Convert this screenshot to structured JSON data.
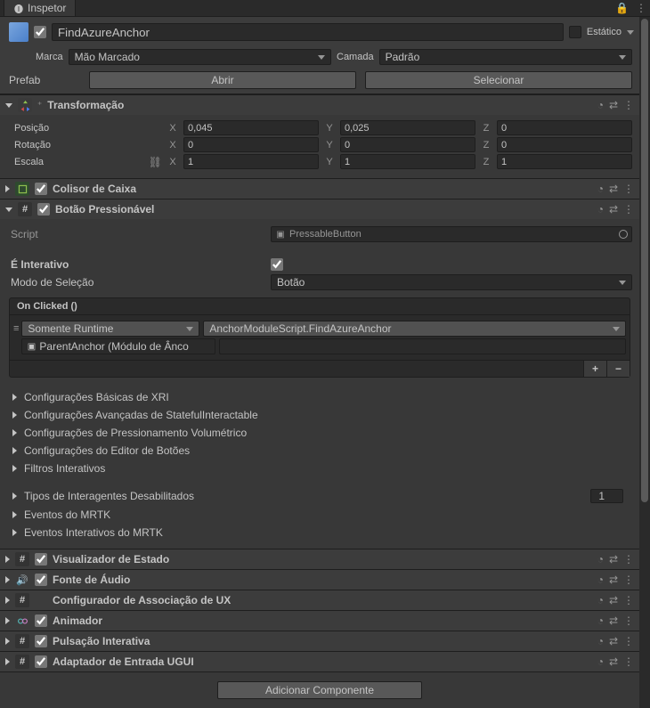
{
  "tab": {
    "title": "Inspetor"
  },
  "object": {
    "name": "FindAzureAnchor",
    "enabled": true,
    "static_label": "Estático",
    "tag_label": "Marca",
    "tag_value": "Mão Marcado",
    "layer_label": "Camada",
    "layer_value": "Padrão",
    "prefab_label": "Prefab",
    "open_btn": "Abrir",
    "select_btn": "Selecionar"
  },
  "transform": {
    "title": "Transformação",
    "position_label": "Posição",
    "rotation_label": "Rotação",
    "scale_label": "Escala",
    "pos": {
      "x": "0,045",
      "y": "0,025",
      "z": "0"
    },
    "rot": {
      "x": "0",
      "y": "0",
      "z": "0"
    },
    "scale": {
      "x": "1",
      "y": "1",
      "z": "1"
    }
  },
  "collider": {
    "title": "Colisor de Caixa",
    "enabled": true
  },
  "pressable": {
    "title": "Botão Pressionável",
    "enabled": true,
    "script_label": "Script",
    "script_value": "PressableButton",
    "interactive_label": "É Interativo",
    "interactive": true,
    "selection_label": "Modo de Seleção",
    "selection_value": "Botão",
    "event_title": "On Clicked ()",
    "runtime_value": "Somente Runtime",
    "target_value": "ParentAnchor (Módulo de Ânco",
    "function_value": "AnchorModuleScript.FindAzureAnchor"
  },
  "foldouts": {
    "xri_basic": "Configurações Básicas de XRI",
    "stateful": "Configurações Avançadas de StatefulInteractable",
    "volumetric": "Configurações de Pressionamento Volumétrico",
    "button_editor": "Configurações do Editor de Botões",
    "filters": "Filtros Interativos",
    "disabled_types": "Tipos de Interagentes Desabilitados",
    "disabled_count": "1",
    "mrtk_events": "Eventos do MRTK",
    "mrtk_interactive": "Eventos Interativos do MRTK"
  },
  "components": {
    "state_viz": "Visualizador de Estado",
    "audio": "Fonte de Áudio",
    "ux_bind": "Configurador de Associação de UX",
    "animator": "Animador",
    "pulse": "Pulsação Interativa",
    "ugui": "Adaptador de Entrada UGUI"
  },
  "add_component": "Adicionar Componente"
}
